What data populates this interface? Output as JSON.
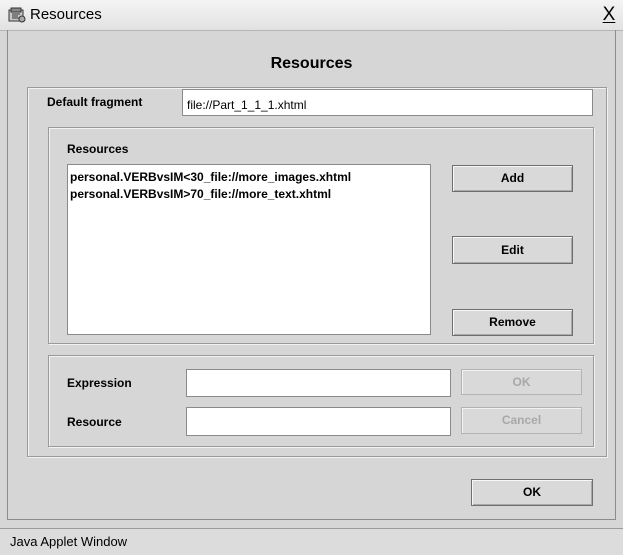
{
  "window": {
    "title": "Resources",
    "close_glyph": "X",
    "icon": "applet-icon"
  },
  "dialog": {
    "heading": "Resources",
    "default_fragment": {
      "label": "Default fragment",
      "value": "file://Part_1_1_1.xhtml"
    },
    "resources": {
      "label": "Resources",
      "items": [
        "personal.VERBvsIM<30_file://more_images.xhtml",
        "personal.VERBvsIM>70_file://more_text.xhtml"
      ],
      "add_label": "Add",
      "edit_label": "Edit",
      "remove_label": "Remove"
    },
    "editor": {
      "expression_label": "Expression",
      "expression_value": "",
      "resource_label": "Resource",
      "resource_value": "",
      "ok_label": "OK",
      "cancel_label": "Cancel"
    },
    "ok_label": "OK"
  },
  "status": {
    "text": "Java Applet Window"
  }
}
